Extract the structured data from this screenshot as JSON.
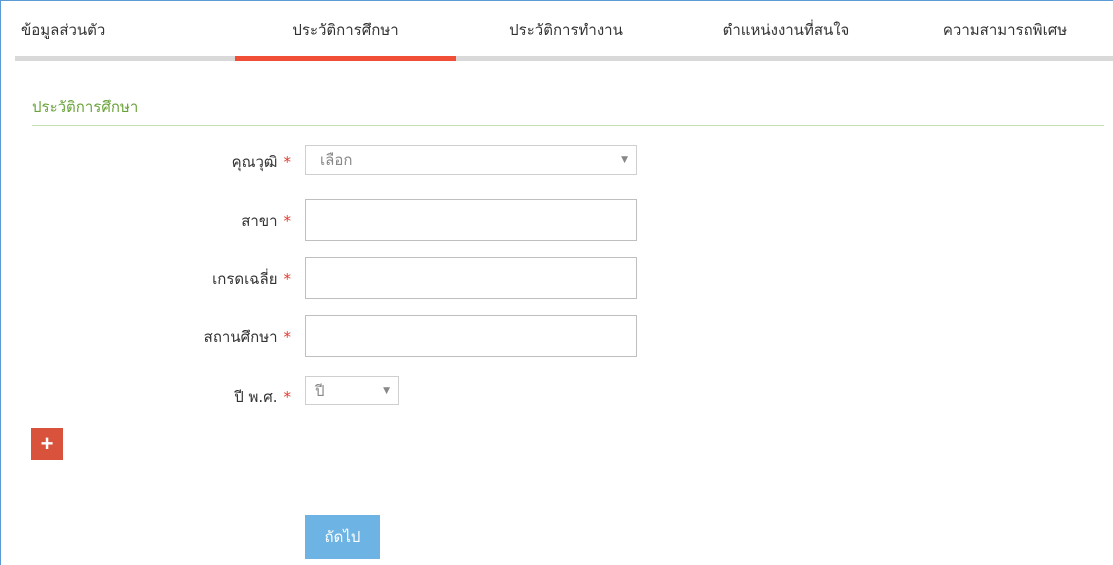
{
  "tabs": [
    {
      "label": "ข้อมูลส่วนตัว",
      "active": false
    },
    {
      "label": "ประวัติการศึกษา",
      "active": true
    },
    {
      "label": "ประวัติการทำงาน",
      "active": false
    },
    {
      "label": "ตำแหน่งงานที่สนใจ",
      "active": false
    },
    {
      "label": "ความสามารถพิเศษ",
      "active": false
    }
  ],
  "section": {
    "title": "ประวัติการศึกษา"
  },
  "form": {
    "required_mark": "*",
    "degree": {
      "label": "คุณวุฒิ",
      "selected": "เลือก"
    },
    "major": {
      "label": "สาขา",
      "value": ""
    },
    "gpa": {
      "label": "เกรดเฉลี่ย",
      "value": ""
    },
    "institution": {
      "label": "สถานศึกษา",
      "value": ""
    },
    "year": {
      "label": "ปี พ.ศ.",
      "selected": "ปี"
    }
  },
  "actions": {
    "add_icon": "plus-icon",
    "add_glyph": "+",
    "next_label": "ถัดไป"
  },
  "colors": {
    "active_tab": "#f04e37",
    "section_title": "#6aa33a",
    "add_button": "#d9533c",
    "next_button": "#6db3e3",
    "required": "#e23b2e"
  }
}
